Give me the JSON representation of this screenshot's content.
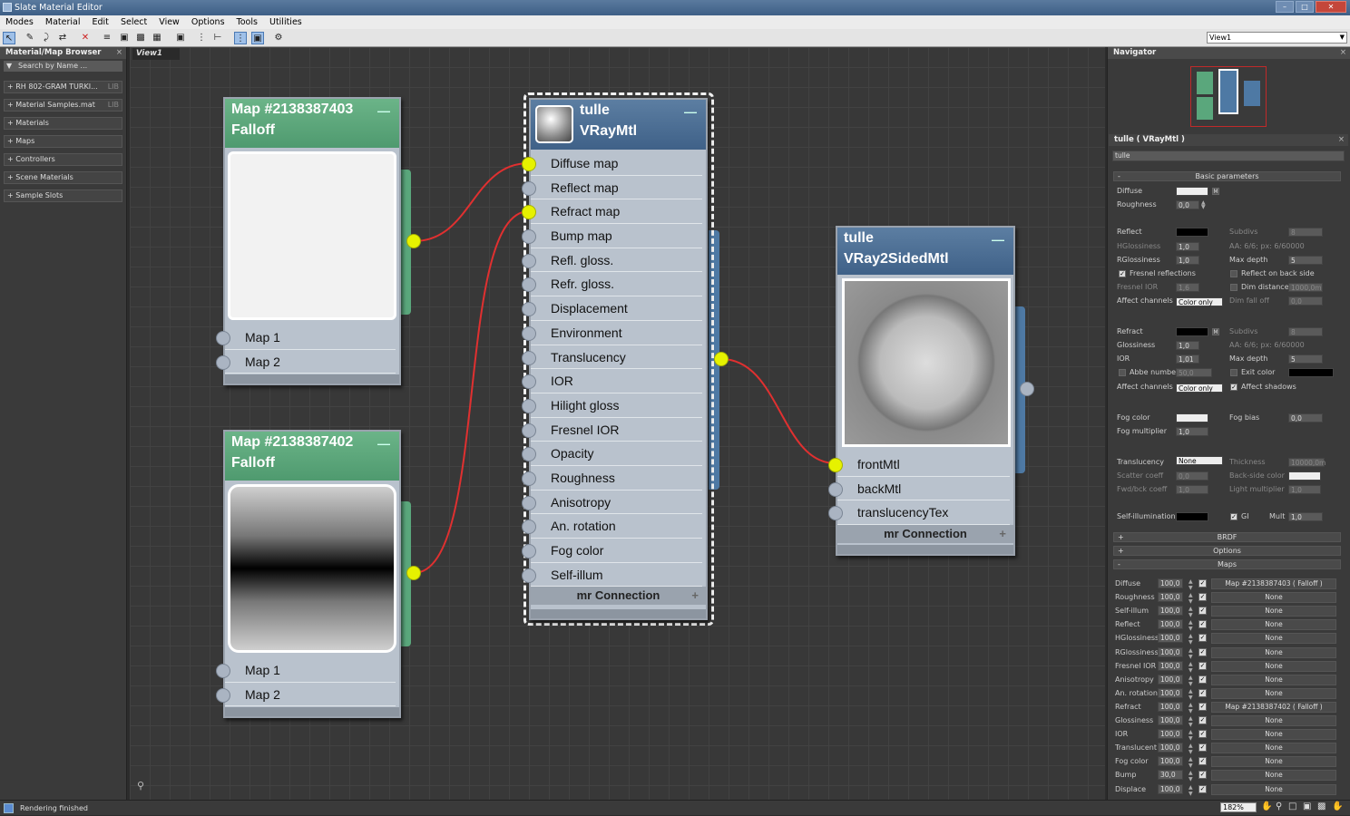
{
  "window": {
    "title": "Slate Material Editor"
  },
  "menu": [
    "Modes",
    "Material",
    "Edit",
    "Select",
    "View",
    "Options",
    "Tools",
    "Utilities"
  ],
  "toolbar": {
    "view_select": "View1"
  },
  "browser": {
    "title": "Material/Map Browser",
    "search_placeholder": "Search by Name ...",
    "groups": [
      {
        "label": "+ RH 802-GRAM TURKI...",
        "tag": "LIB"
      },
      {
        "label": "+ Material Samples.mat",
        "tag": "LIB"
      },
      {
        "label": "+ Materials",
        "tag": ""
      },
      {
        "label": "+ Maps",
        "tag": ""
      },
      {
        "label": "+ Controllers",
        "tag": ""
      },
      {
        "label": "+ Scene Materials",
        "tag": ""
      },
      {
        "label": "+ Sample Slots",
        "tag": ""
      }
    ]
  },
  "view": {
    "tab": "View1"
  },
  "nodes": {
    "map1": {
      "title": "Map #2138387403",
      "type": "Falloff",
      "slots": [
        "Map 1",
        "Map 2"
      ]
    },
    "map2": {
      "title": "Map #2138387402",
      "type": "Falloff",
      "slots": [
        "Map 1",
        "Map 2"
      ]
    },
    "vray": {
      "title": "tulle",
      "type": "VRayMtl",
      "slots": [
        "Diffuse map",
        "Reflect map",
        "Refract map",
        "Bump map",
        "Refl. gloss.",
        "Refr. gloss.",
        "Displacement",
        "Environment",
        "Translucency",
        "IOR",
        "Hilight gloss",
        "Fresnel IOR",
        "Opacity",
        "Roughness",
        "Anisotropy",
        "An. rotation",
        "Fog color",
        "Self-illum"
      ],
      "mr": "mr Connection"
    },
    "two": {
      "title": "tulle",
      "type": "VRay2SidedMtl",
      "slots": [
        "frontMtl",
        "backMtl",
        "translucencyTex"
      ],
      "mr": "mr Connection"
    }
  },
  "navigator": {
    "title": "Navigator"
  },
  "params": {
    "title": "tulle  ( VRayMtl )",
    "name": "tulle",
    "rollout_basic": "Basic parameters",
    "diffuse": "Diffuse",
    "roughness": "Roughness",
    "roughness_val": "0,0",
    "reflect": "Reflect",
    "hgloss": "HGlossiness",
    "hgloss_val": "1,0",
    "rgloss": "RGlossiness",
    "rgloss_val": "1,0",
    "subdivs": "Subdivs",
    "subdivs_val": "8",
    "aa_reflect": "AA: 6/6; px: 6/60000",
    "maxdepth": "Max depth",
    "maxdepth_val": "5",
    "fresnel": "Fresnel reflections",
    "reflect_back": "Reflect on back side",
    "fresnel_ior": "Fresnel IOR",
    "fresnel_ior_val": "1,6",
    "dim_distance": "Dim distance",
    "dim_val": "1000,0m",
    "affect_channels": "Affect channels",
    "color_only": "Color only",
    "dim_falloff": "Dim fall off",
    "dim_falloff_val": "0,0",
    "refract": "Refract",
    "glossiness": "Glossiness",
    "gloss_val": "1,0",
    "ior": "IOR",
    "ior_val": "1,01",
    "aa_refract": "AA: 6/6; px: 6/60000",
    "abbe": "Abbe number",
    "abbe_val": "50,0",
    "exit_color": "Exit color",
    "affect_shadows": "Affect shadows",
    "fog_color": "Fog color",
    "fog_mult": "Fog multiplier",
    "fog_mult_val": "1,0",
    "fog_bias": "Fog bias",
    "fog_bias_val": "0,0",
    "translucency": "Translucency",
    "trans_val": "None",
    "thickness": "Thickness",
    "thickness_val": "10000,0m",
    "scatter": "Scatter coeff",
    "scatter_val": "0,0",
    "backside": "Back-side color",
    "fwdbck": "Fwd/bck coeff",
    "fwdbck_val": "1,0",
    "light_mult": "Light multiplier",
    "light_mult_val": "1,0",
    "selfillum": "Self-illumination",
    "gi": "GI",
    "mult": "Mult",
    "mult_val": "1,0",
    "brdf": "BRDF",
    "options": "Options",
    "maps": "Maps",
    "map_rows": [
      {
        "label": "Diffuse",
        "amount": "100,0",
        "map": "Map #2138387403  ( Falloff )"
      },
      {
        "label": "Roughness",
        "amount": "100,0",
        "map": "None"
      },
      {
        "label": "Self-illum",
        "amount": "100,0",
        "map": "None"
      },
      {
        "label": "Reflect",
        "amount": "100,0",
        "map": "None"
      },
      {
        "label": "HGlossiness",
        "amount": "100,0",
        "map": "None"
      },
      {
        "label": "RGlossiness",
        "amount": "100,0",
        "map": "None"
      },
      {
        "label": "Fresnel IOR",
        "amount": "100,0",
        "map": "None"
      },
      {
        "label": "Anisotropy",
        "amount": "100,0",
        "map": "None"
      },
      {
        "label": "An. rotation",
        "amount": "100,0",
        "map": "None"
      },
      {
        "label": "Refract",
        "amount": "100,0",
        "map": "Map #2138387402  ( Falloff )"
      },
      {
        "label": "Glossiness",
        "amount": "100,0",
        "map": "None"
      },
      {
        "label": "IOR",
        "amount": "100,0",
        "map": "None"
      },
      {
        "label": "Translucent",
        "amount": "100,0",
        "map": "None"
      },
      {
        "label": "Fog color",
        "amount": "100,0",
        "map": "None"
      },
      {
        "label": "Bump",
        "amount": "30,0",
        "map": "None"
      },
      {
        "label": "Displace",
        "amount": "100,0",
        "map": "None"
      }
    ]
  },
  "status": {
    "text": "Rendering finished",
    "zoom": "182%"
  }
}
